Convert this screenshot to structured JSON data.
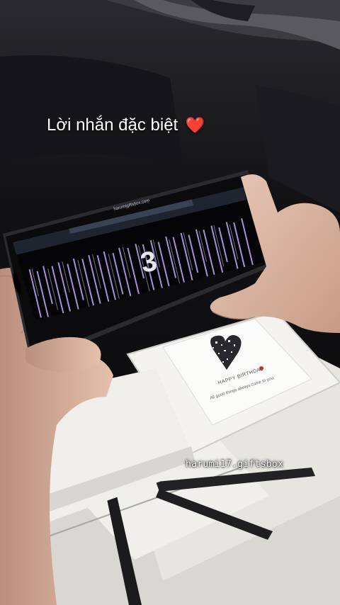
{
  "caption": {
    "text": "Lời nhắn đặc biệt",
    "emoji": "❤️"
  },
  "phone_screen": {
    "countdown": "3",
    "url": "harumigiftsbox.com",
    "effect": "matrix rain (purple)"
  },
  "card": {
    "title": "HAPPY BIRTHDAY",
    "subtitle": "All good things always come to you."
  },
  "watermark": {
    "handle": "harumi17.giftsbox"
  },
  "colors": {
    "matrix": "#c6a8ff",
    "heart": "#e0262c",
    "background": "#0e0e10"
  }
}
